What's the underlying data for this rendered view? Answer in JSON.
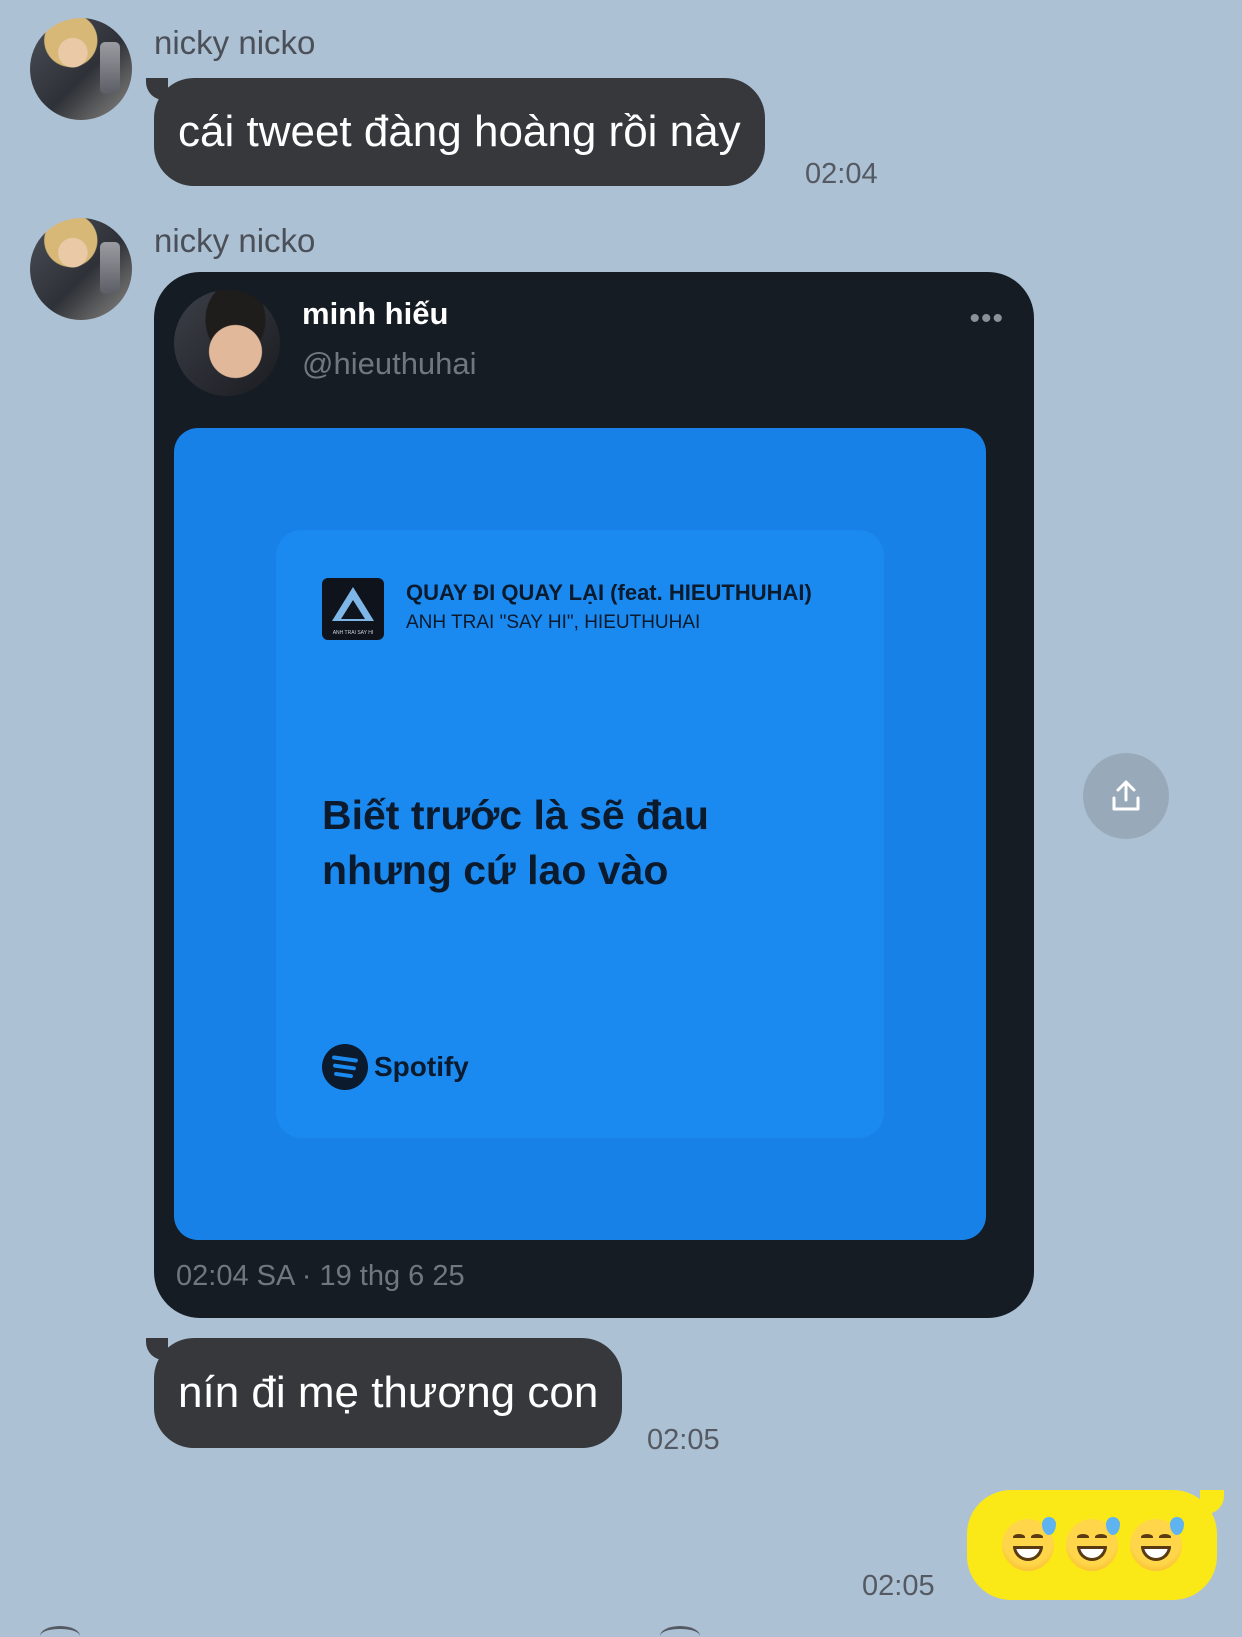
{
  "messages": [
    {
      "sender": "nicky nicko",
      "text": "cái tweet đàng hoàng rồi này",
      "time": "02:04"
    },
    {
      "sender": "nicky nicko",
      "text": "nín đi mẹ thương con",
      "time": "02:05"
    }
  ],
  "tweet": {
    "name": "minh hiếu",
    "handle": "@hieuthuhai",
    "more": "•••",
    "date": "02:04 SA · 19 thg 6 25",
    "spotify_card": {
      "song_title": "QUAY ĐI QUAY LẠI (feat. HIEUTHUHAI)",
      "artist": "ANH TRAI \"SAY HI\", HIEUTHUHAI",
      "cover_caption": "ANH TRAI SAY HI",
      "lyric": "Biết trước là sẽ đau nhưng cứ lao vào",
      "brand": "Spotify"
    }
  },
  "outgoing": {
    "emoji": "😅😅😅",
    "time": "02:05"
  },
  "colors": {
    "background": "#adc1d5",
    "incoming_bubble": "#36383c",
    "outgoing_bubble": "#fbe817",
    "tweet_bg": "#151c24",
    "spotify_blue": "#1b8af0"
  }
}
